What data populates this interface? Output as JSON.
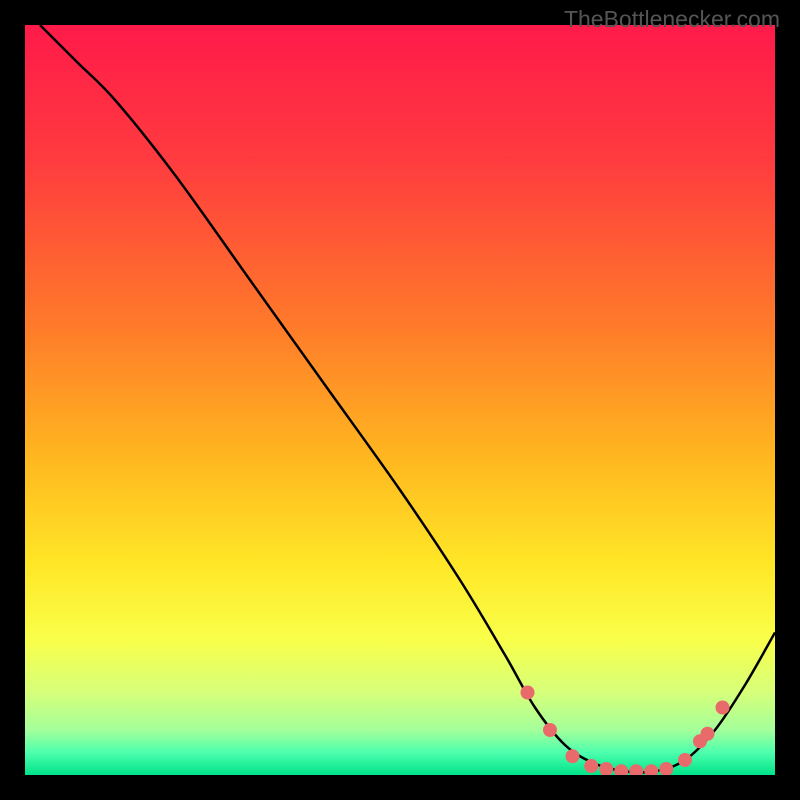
{
  "watermark": "TheBottlenecker.com",
  "chart_data": {
    "type": "line",
    "title": "",
    "xlabel": "",
    "ylabel": "",
    "xlim": [
      0,
      100
    ],
    "ylim": [
      0,
      100
    ],
    "gradient_stops": [
      {
        "offset": 0,
        "color": "#ff1a4a"
      },
      {
        "offset": 18,
        "color": "#ff3b3f"
      },
      {
        "offset": 40,
        "color": "#ff7a2a"
      },
      {
        "offset": 58,
        "color": "#ffb81f"
      },
      {
        "offset": 72,
        "color": "#ffe727"
      },
      {
        "offset": 82,
        "color": "#f9ff4a"
      },
      {
        "offset": 89,
        "color": "#d6ff7a"
      },
      {
        "offset": 94,
        "color": "#a4ff9a"
      },
      {
        "offset": 97,
        "color": "#4dffad"
      },
      {
        "offset": 100,
        "color": "#00e38a"
      }
    ],
    "curve": [
      {
        "x": 2,
        "y": 100
      },
      {
        "x": 7,
        "y": 95
      },
      {
        "x": 12,
        "y": 90
      },
      {
        "x": 20,
        "y": 80
      },
      {
        "x": 30,
        "y": 66
      },
      {
        "x": 40,
        "y": 52
      },
      {
        "x": 50,
        "y": 38
      },
      {
        "x": 58,
        "y": 26
      },
      {
        "x": 64,
        "y": 16
      },
      {
        "x": 68,
        "y": 9
      },
      {
        "x": 72,
        "y": 4
      },
      {
        "x": 76,
        "y": 1.5
      },
      {
        "x": 80,
        "y": 0.5
      },
      {
        "x": 84,
        "y": 0.5
      },
      {
        "x": 88,
        "y": 2
      },
      {
        "x": 92,
        "y": 6
      },
      {
        "x": 96,
        "y": 12
      },
      {
        "x": 100,
        "y": 19
      }
    ],
    "markers": [
      {
        "x": 67,
        "y": 11
      },
      {
        "x": 70,
        "y": 6
      },
      {
        "x": 73,
        "y": 2.5
      },
      {
        "x": 75.5,
        "y": 1.2
      },
      {
        "x": 77.5,
        "y": 0.8
      },
      {
        "x": 79.5,
        "y": 0.5
      },
      {
        "x": 81.5,
        "y": 0.5
      },
      {
        "x": 83.5,
        "y": 0.5
      },
      {
        "x": 85.5,
        "y": 0.8
      },
      {
        "x": 88,
        "y": 2
      },
      {
        "x": 90,
        "y": 4.5
      },
      {
        "x": 91,
        "y": 5.5
      },
      {
        "x": 93,
        "y": 9
      }
    ],
    "marker_color": "#e96a6a",
    "marker_radius": 7
  }
}
